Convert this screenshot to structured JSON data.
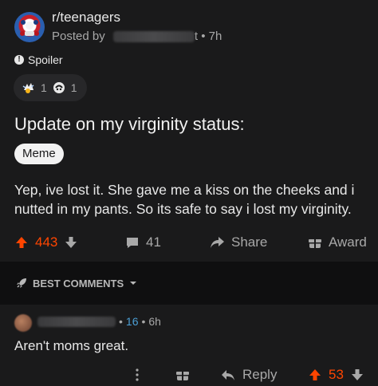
{
  "post": {
    "subreddit": "r/teenagers",
    "posted_by_prefix": "Posted by",
    "username_tail": "t",
    "separator": "•",
    "time": "7h",
    "spoiler_label": "Spoiler",
    "awards": [
      {
        "icon": "wholesome-award-icon",
        "count": "1"
      },
      {
        "icon": "helpful-award-icon",
        "count": "1"
      }
    ],
    "title": "Update on my virginity status:",
    "flair": "Meme",
    "body": "Yep, ive lost it. She gave me a kiss on the cheeks and i nutted in my pants. So its safe to say i lost my virginity.",
    "score": "443",
    "comments": "41",
    "share_label": "Share",
    "award_label": "Award"
  },
  "sort": {
    "label": "BEST COMMENTS"
  },
  "comment": {
    "separator": "•",
    "score": "16",
    "time": "6h",
    "body": "Aren't moms great.",
    "reply_label": "Reply",
    "votes": "53"
  },
  "colors": {
    "background": "#1a1a1b",
    "upvote": "#ff4500",
    "comment_score": "#4b9fd5"
  }
}
